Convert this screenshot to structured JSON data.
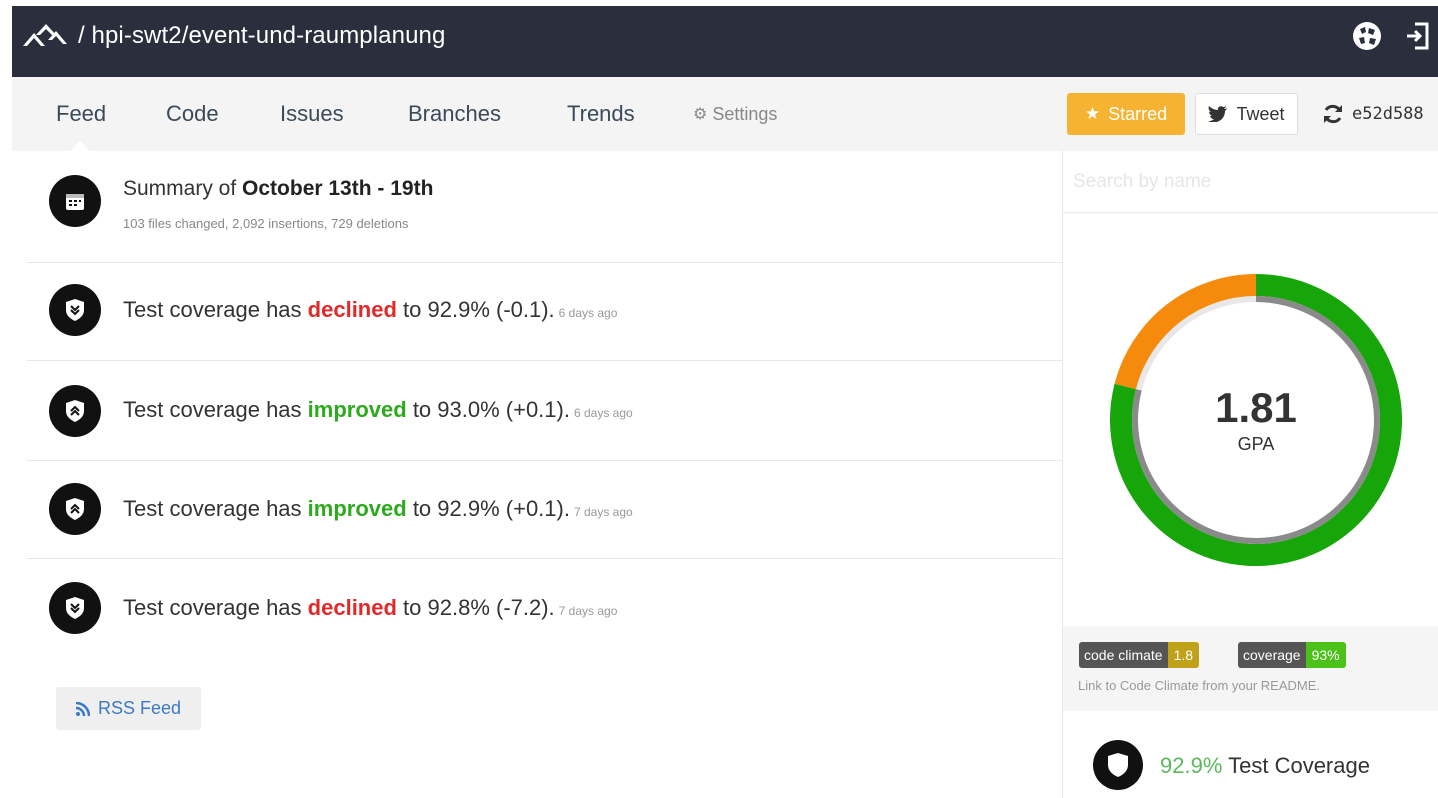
{
  "header": {
    "repo_path": "/ hpi-swt2/event-und-raumplanung",
    "logo_icon": "codeclimate-logo-icon",
    "globe_icon": "globe-icon",
    "signin_icon": "sign-in-icon"
  },
  "nav": {
    "tabs": [
      {
        "label": "Feed",
        "active": true
      },
      {
        "label": "Code",
        "active": false
      },
      {
        "label": "Issues",
        "active": false
      },
      {
        "label": "Branches",
        "active": false
      },
      {
        "label": "Trends",
        "active": false
      },
      {
        "label": "Settings",
        "active": false
      }
    ],
    "starred_label": "Starred",
    "tweet_label": "Tweet",
    "commit_hash": "e52d588"
  },
  "feed": {
    "summary": {
      "prefix": "Summary of ",
      "range": "October 13th - 19th",
      "details": "103 files changed, 2,092 insertions, 729 deletions"
    },
    "items": [
      {
        "prefix": "Test coverage has ",
        "status": "declined",
        "suffix": " to 92.9% (-0.1).",
        "ago": "6 days ago"
      },
      {
        "prefix": "Test coverage has ",
        "status": "improved",
        "suffix": " to 93.0% (+0.1).",
        "ago": "6 days ago"
      },
      {
        "prefix": "Test coverage has ",
        "status": "improved",
        "suffix": " to 92.9% (+0.1).",
        "ago": "7 days ago"
      },
      {
        "prefix": "Test coverage has ",
        "status": "declined",
        "suffix": " to 92.8% (-7.2).",
        "ago": "7 days ago"
      }
    ],
    "rss_label": "RSS Feed"
  },
  "sidebar": {
    "search_placeholder": "Search by name",
    "gpa": {
      "value": "1.81",
      "label": "GPA",
      "segments": [
        {
          "name": "green",
          "fraction": 0.79,
          "color": "#17a60a"
        },
        {
          "name": "orange",
          "fraction": 0.21,
          "color": "#f58a0c"
        }
      ],
      "inner_ring_color": "#8a8a8a"
    },
    "badges": [
      {
        "key": "code climate",
        "value": "1.8",
        "color": "#c1a11a"
      },
      {
        "key": "coverage",
        "value": "93%",
        "color": "#4cc11a"
      }
    ],
    "badge_hint": "Link to Code Climate from your README.",
    "coverage": {
      "percent": "92.9%",
      "label": " Test Coverage"
    }
  },
  "colors": {
    "topbar": "#2b2f3d",
    "starred": "#f6b331",
    "declined": "#e02a2a",
    "improved": "#2eaa1f",
    "link": "#3b7ac4"
  }
}
